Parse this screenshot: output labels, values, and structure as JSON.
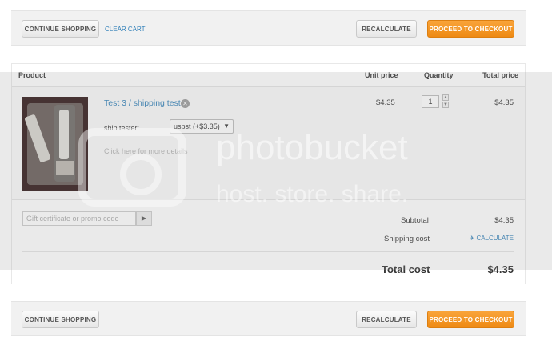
{
  "top_bar": {
    "continue_label": "CONTINUE SHOPPING",
    "clear_label": "CLEAR CART",
    "recalc_label": "RECALCULATE",
    "checkout_label": "PROCEED TO CHECKOUT"
  },
  "table": {
    "headers": {
      "product": "Product",
      "unit_price": "Unit price",
      "quantity": "Quantity",
      "total_price": "Total price"
    },
    "item": {
      "title": "Test 3 / shipping test",
      "ship_label": "ship tester:",
      "ship_option": "uspst (+$3.35)",
      "more_details": "Click here for more details",
      "unit_price": "$4.35",
      "quantity": "1",
      "total_price": "$4.35"
    }
  },
  "summary": {
    "promo_placeholder": "Gift certificate or promo code",
    "subtotal_label": "Subtotal",
    "subtotal_value": "$4.35",
    "shipping_label": "Shipping cost",
    "calculate_label": "CALCULATE",
    "total_label": "Total cost",
    "total_value": "$4.35"
  },
  "bottom_bar": {
    "continue_label": "CONTINUE SHOPPING",
    "recalc_label": "RECALCULATE",
    "checkout_label": "PROCEED TO CHECKOUT"
  },
  "watermark": {
    "line1": "photobucket",
    "line2": "host. store. share."
  },
  "colors": {
    "accent_link": "#2f7fb8",
    "checkout_orange": "#f39a2b"
  }
}
